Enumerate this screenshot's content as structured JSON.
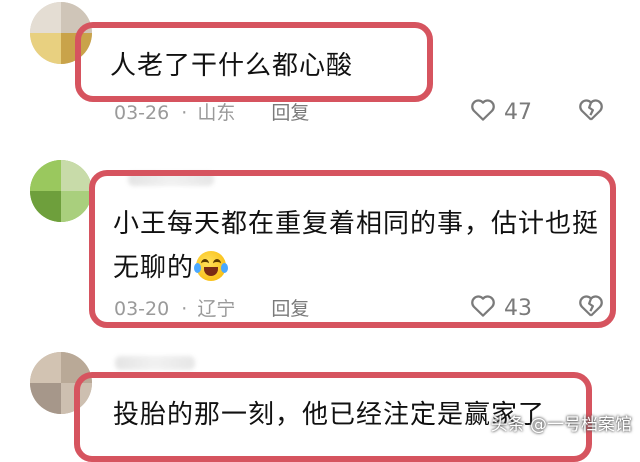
{
  "comments": [
    {
      "text_lines": [
        "人老了干什么都心酸"
      ],
      "date": "03-26",
      "location": "山东",
      "reply_label": "回复",
      "likes": "47",
      "like_icon": "heart-outline-icon",
      "dislike_icon": "broken-heart-icon"
    },
    {
      "text_lines": [
        "小王每天都在重复着相同的事，估计也挺",
        "无聊的"
      ],
      "emoji": "laugh-cry-emoji",
      "date": "03-20",
      "location": "辽宁",
      "reply_label": "回复",
      "likes": "43",
      "like_icon": "heart-outline-icon",
      "dislike_icon": "broken-heart-icon"
    },
    {
      "text_lines": [
        "投胎的那一刻，他已经注定是赢家了"
      ]
    }
  ],
  "watermark": "头条 @一号档案馆",
  "colors": {
    "highlight": "#d6545f",
    "text": "#111111",
    "meta": "#9a9a9a"
  }
}
